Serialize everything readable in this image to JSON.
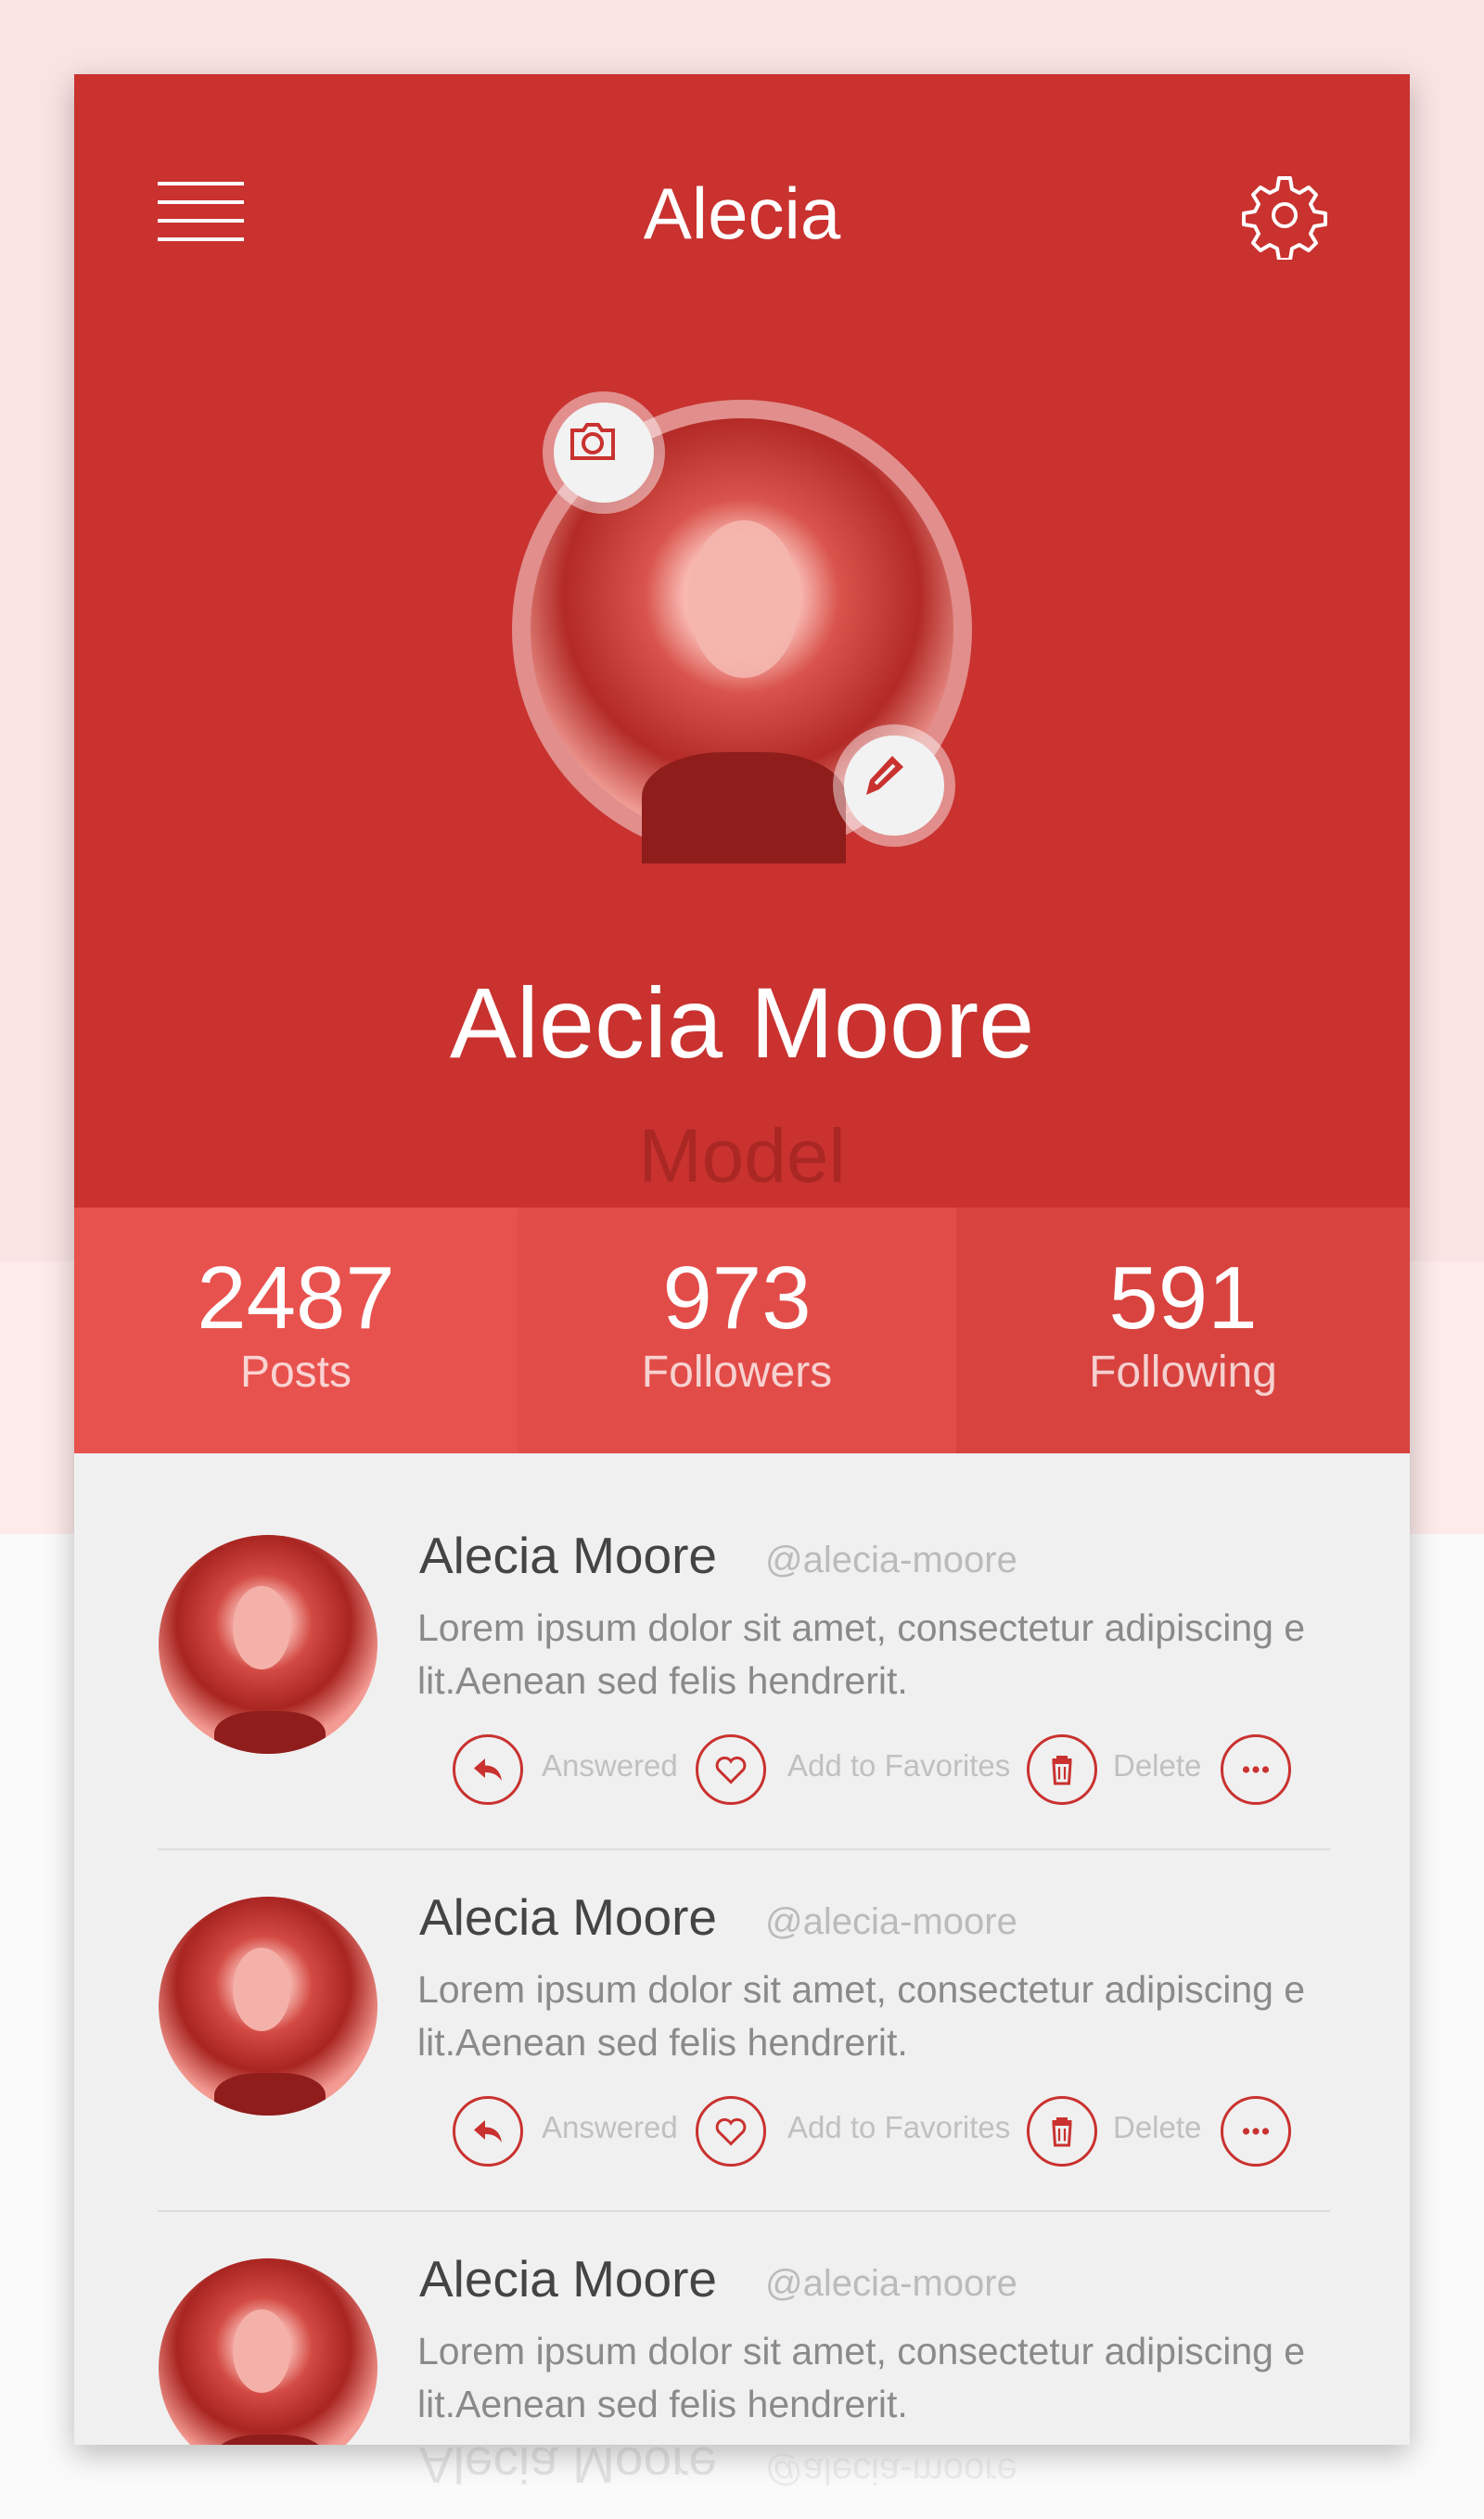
{
  "header": {
    "title": "Alecia",
    "menu_icon": "hamburger-menu-icon",
    "settings_icon": "gear-icon"
  },
  "profile": {
    "name": "Alecia Moore",
    "role": "Model",
    "camera_icon": "camera-icon",
    "edit_icon": "pencil-icon"
  },
  "stats": [
    {
      "value": "2487",
      "label": "Posts"
    },
    {
      "value": "973",
      "label": "Followers"
    },
    {
      "value": "591",
      "label": "Following"
    }
  ],
  "colors": {
    "primary": "#c9322f",
    "stat_posts": "#e8524e",
    "stat_followers": "#e24c48",
    "stat_following": "#d8433f",
    "list_bg": "#f0f0f0"
  },
  "posts": [
    {
      "name": "Alecia Moore",
      "handle": "@alecia-moore",
      "line1": "Lorem ipsum dolor sit amet, consectetur adipiscing e",
      "line2": "lit.Aenean sed felis hendrerit."
    },
    {
      "name": "Alecia Moore",
      "handle": "@alecia-moore",
      "line1": "Lorem ipsum dolor sit amet, consectetur adipiscing e",
      "line2": "lit.Aenean sed felis hendrerit."
    },
    {
      "name": "Alecia Moore",
      "handle": "@alecia-moore",
      "line1": "Lorem ipsum dolor sit amet, consectetur adipiscing e",
      "line2": "lit.Aenean sed felis hendrerit."
    }
  ],
  "actions": {
    "answered": "Answered",
    "favorite": "Add to Favorites",
    "delete": "Delete"
  }
}
